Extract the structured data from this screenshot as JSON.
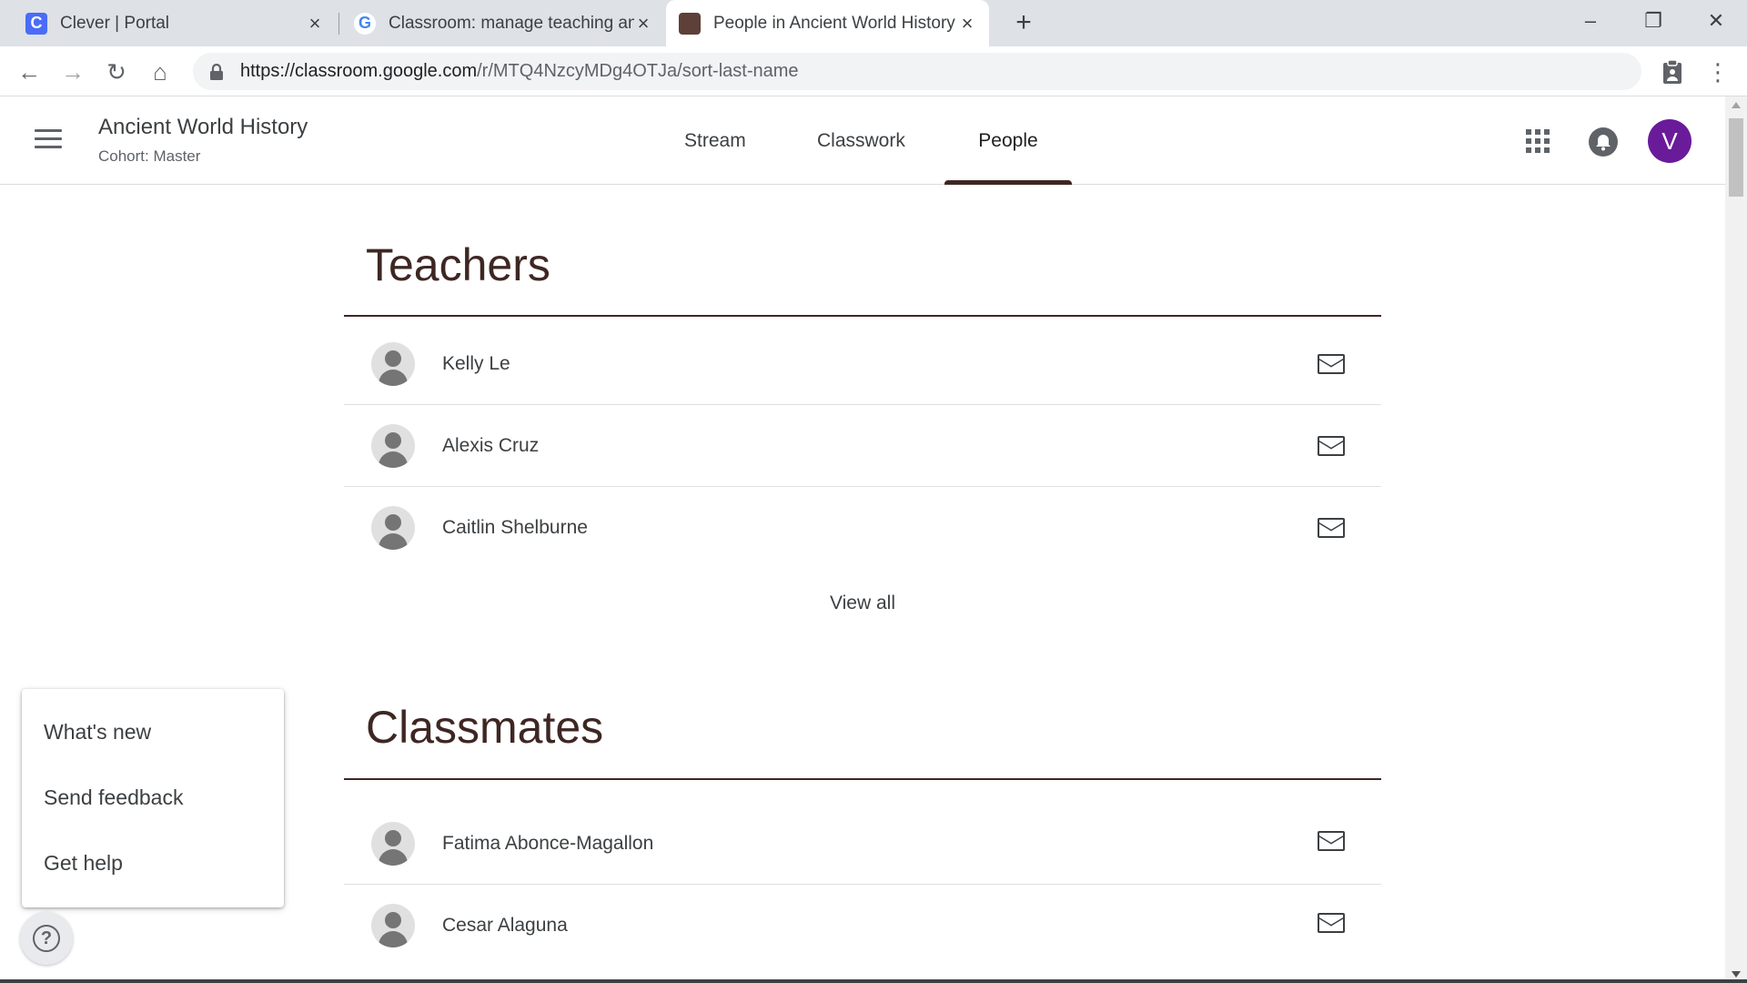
{
  "browser": {
    "tabs": [
      {
        "title": "Clever | Portal",
        "favicon": "C",
        "favicon_color": "#4a6cf7",
        "icon": "clever-favicon"
      },
      {
        "title": "Classroom: manage teaching and",
        "favicon": "G",
        "favicon_color": "#4285f4",
        "icon": "google-favicon"
      },
      {
        "title": "People in Ancient World History",
        "favicon": "",
        "favicon_color": "#5d4037",
        "icon": "classroom-favicon"
      }
    ],
    "url_host": "https://classroom.google.com",
    "url_path": "/r/MTQ4NzcyMDg4OTJa/sort-last-name"
  },
  "header": {
    "course_title": "Ancient World History",
    "course_subtitle": "Cohort: Master",
    "tabs": [
      {
        "label": "Stream"
      },
      {
        "label": "Classwork"
      },
      {
        "label": "People"
      }
    ],
    "avatar_letter": "V",
    "avatar_color": "#6a1b9a"
  },
  "teachers": {
    "title": "Teachers",
    "people": [
      {
        "name": "Kelly Le"
      },
      {
        "name": "Alexis Cruz"
      },
      {
        "name": "Caitlin Shelburne"
      }
    ],
    "view_all_label": "View all"
  },
  "classmates": {
    "title": "Classmates",
    "people": [
      {
        "name": "Fatima Abonce-Magallon"
      },
      {
        "name": "Cesar Alaguna"
      }
    ]
  },
  "help_menu": {
    "items": [
      {
        "label": "What's new"
      },
      {
        "label": "Send feedback"
      },
      {
        "label": "Get help"
      }
    ]
  },
  "colors": {
    "accent": "#3e2723",
    "tabstrip": "#dee1e6"
  }
}
